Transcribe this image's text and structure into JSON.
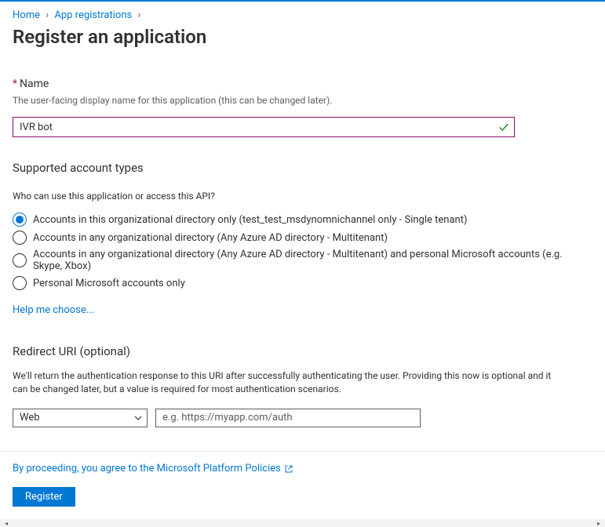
{
  "breadcrumb": {
    "items": [
      {
        "label": "Home"
      },
      {
        "label": "App registrations"
      }
    ]
  },
  "page": {
    "title": "Register an application"
  },
  "nameField": {
    "label": "Name",
    "required_marker": "*",
    "description": "The user-facing display name for this application (this can be changed later).",
    "value": "IVR bot"
  },
  "accountTypes": {
    "heading": "Supported account types",
    "question": "Who can use this application or access this API?",
    "options": [
      {
        "label": "Accounts in this organizational directory only (test_test_msdynomnichannel only - Single tenant)",
        "selected": true
      },
      {
        "label": "Accounts in any organizational directory (Any Azure AD directory - Multitenant)",
        "selected": false
      },
      {
        "label": "Accounts in any organizational directory (Any Azure AD directory - Multitenant) and personal Microsoft accounts (e.g. Skype, Xbox)",
        "selected": false
      },
      {
        "label": "Personal Microsoft accounts only",
        "selected": false
      }
    ],
    "help_link": "Help me choose..."
  },
  "redirectUri": {
    "heading": "Redirect URI (optional)",
    "description": "We'll return the authentication response to this URI after successfully authenticating the user. Providing this now is optional and it can be changed later, but a value is required for most authentication scenarios.",
    "platform_selected": "Web",
    "uri_placeholder": "e.g. https://myapp.com/auth",
    "uri_value": ""
  },
  "footer": {
    "policies_text": "By proceeding, you agree to the Microsoft Platform Policies",
    "register_label": "Register"
  }
}
